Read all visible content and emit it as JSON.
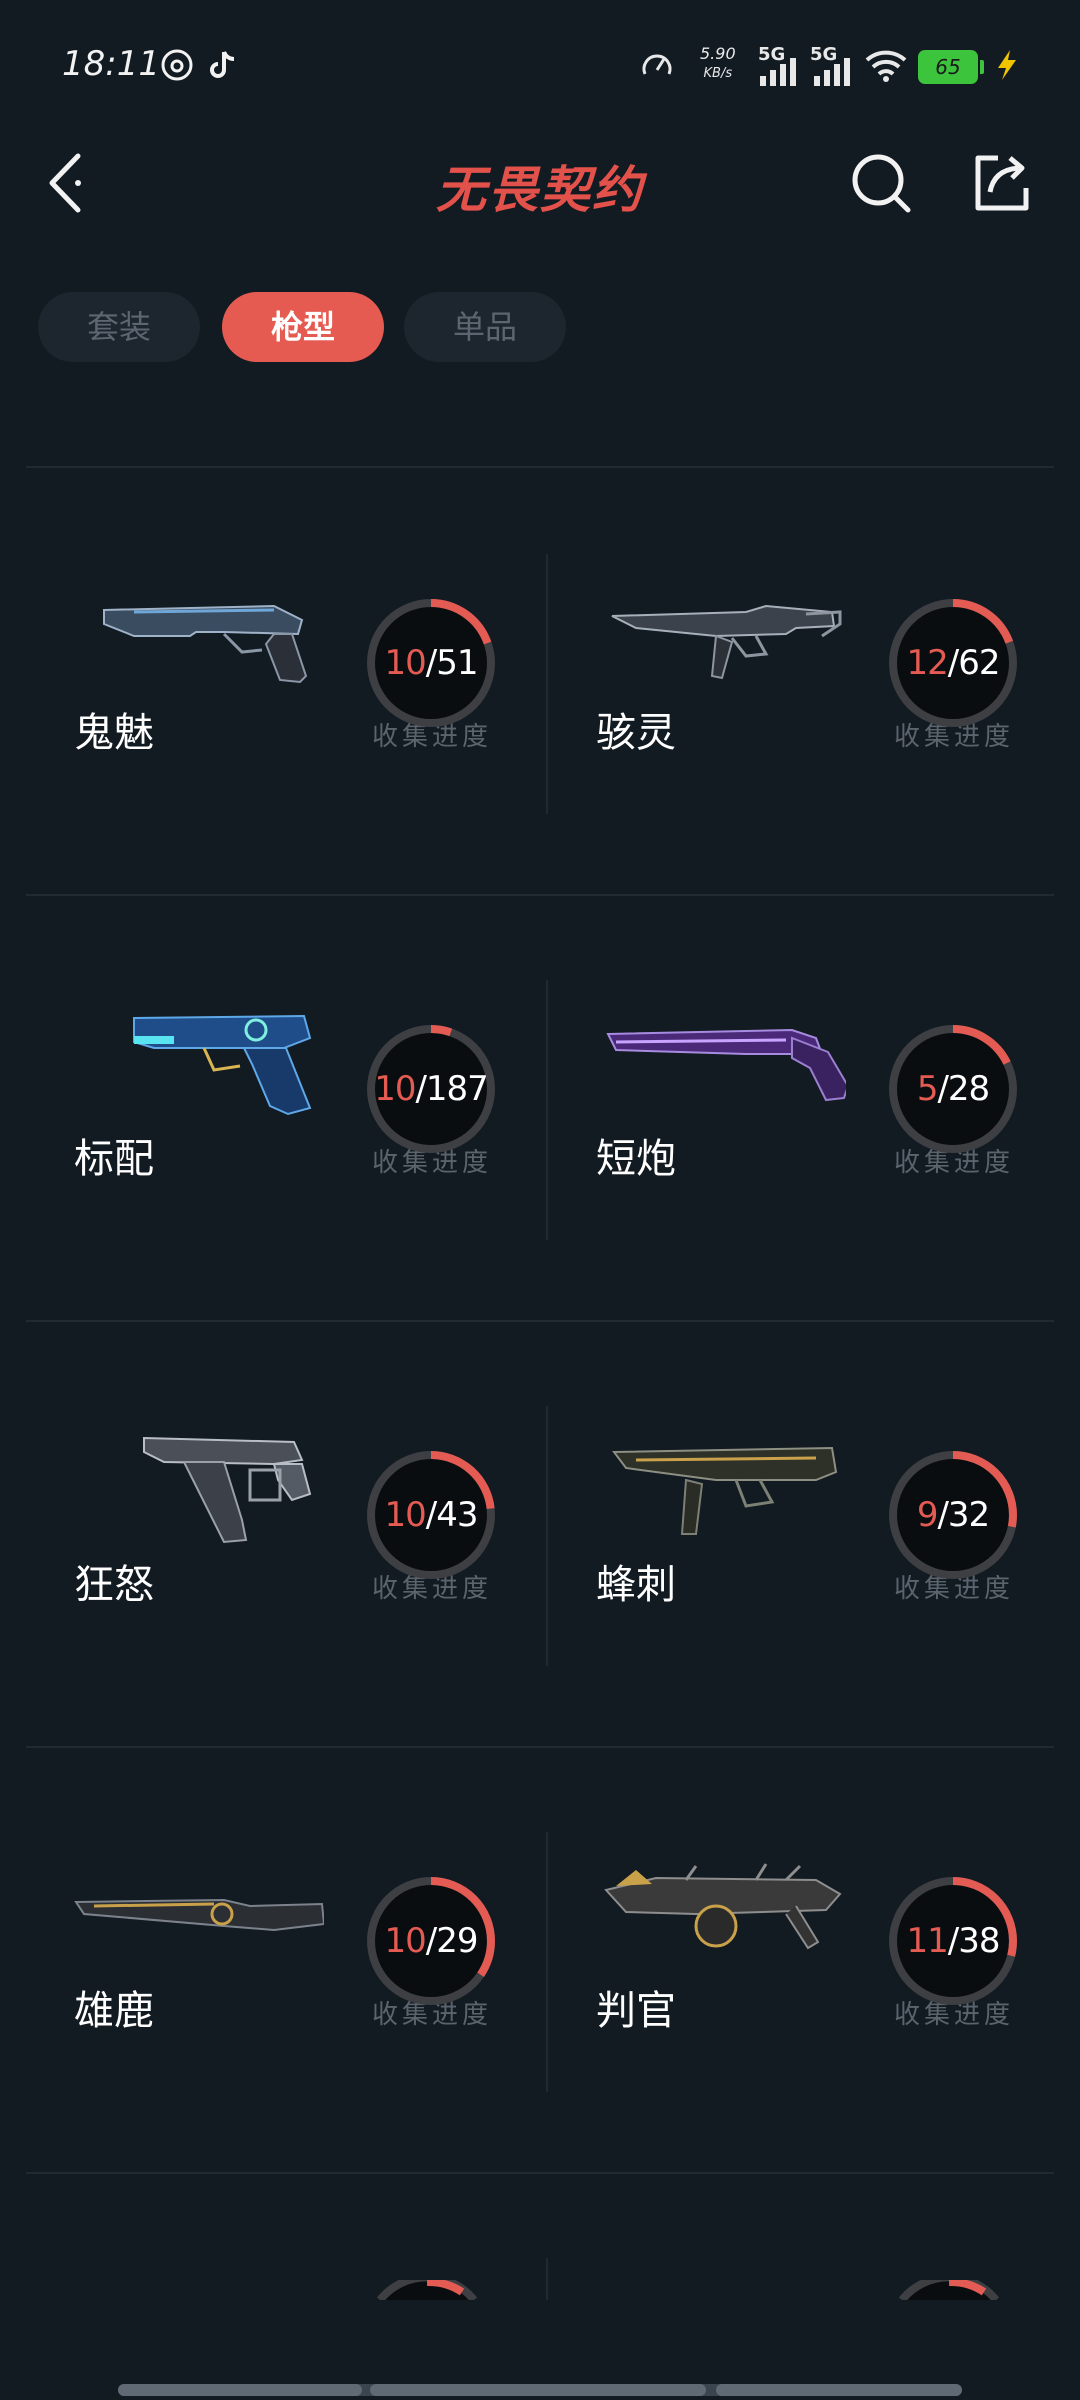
{
  "status_bar": {
    "time": "18:11",
    "net_speed_value": "5.90",
    "net_speed_unit": "KB/s",
    "signal1": "5G",
    "signal2": "5G",
    "battery": "65"
  },
  "header": {
    "title": "无畏契约",
    "back_icon": "chevron-left-icon",
    "search_icon": "search-icon",
    "share_icon": "share-icon"
  },
  "tabs": [
    {
      "label": "套装",
      "active": false
    },
    {
      "label": "枪型",
      "active": true
    },
    {
      "label": "单品",
      "active": false
    }
  ],
  "accent_color": "#e35b52",
  "progress_label": "收集进度",
  "weapons": [
    {
      "name": "鬼魅",
      "collected": 10,
      "total": 51,
      "collected_text": "10",
      "total_text": "/51",
      "gun": "ghost-pistol"
    },
    {
      "name": "骇灵",
      "collected": 12,
      "total": 62,
      "collected_text": "12",
      "total_text": "/62",
      "gun": "spectre-smg"
    },
    {
      "name": "标配",
      "collected": 10,
      "total": 187,
      "collected_text": "10",
      "total_text": "/187",
      "gun": "classic-pistol"
    },
    {
      "name": "短炮",
      "collected": 5,
      "total": 28,
      "collected_text": "5",
      "total_text": "/28",
      "gun": "shorty-shotgun"
    },
    {
      "name": "狂怒",
      "collected": 10,
      "total": 43,
      "collected_text": "10",
      "total_text": "/43",
      "gun": "frenzy-pistol"
    },
    {
      "name": "蜂刺",
      "collected": 9,
      "total": 32,
      "collected_text": "9",
      "total_text": "/32",
      "gun": "stinger-smg"
    },
    {
      "name": "雄鹿",
      "collected": 10,
      "total": 29,
      "collected_text": "10",
      "total_text": "/29",
      "gun": "bucky-shotgun"
    },
    {
      "name": "判官",
      "collected": 11,
      "total": 38,
      "collected_text": "11",
      "total_text": "/38",
      "gun": "judge-shotgun"
    }
  ]
}
